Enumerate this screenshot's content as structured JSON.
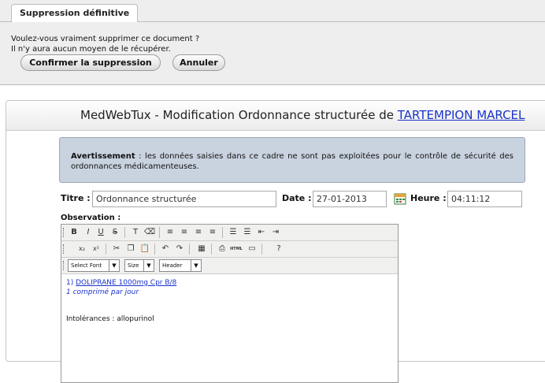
{
  "confirm": {
    "tab_title": "Suppression définitive",
    "message_line1": "Voulez-vous vraiment supprimer ce document ?",
    "message_line2": "Il n'y aura aucun moyen de le récupérer.",
    "confirm_button": "Confirmer la suppression",
    "cancel_button": "Annuler"
  },
  "main": {
    "title_prefix": "MedWebTux - Modification Ordonnance structurée de ",
    "patient_name": "TARTEMPION MARCEL",
    "warning_bold": "Avertissement",
    "warning_text": " : les données saisies dans ce cadre ne sont pas exploitées pour le contrôle de sécurité des ordonnances médicamenteuses."
  },
  "form": {
    "titre_label": "Titre :",
    "titre_value": "Ordonnance structurée",
    "date_label": "Date :",
    "date_value": "27-01-2013",
    "heure_label": "Heure :",
    "heure_value": "04:11:12",
    "observation_label": "Observation :"
  },
  "editor": {
    "toolbar1": [
      "B",
      "I",
      "U",
      "S"
    ],
    "font_select": "Select Font",
    "size_select": "Size",
    "format_select": "Header",
    "content": {
      "drug_index": "1) ",
      "drug_link": "DOLIPRANE 1000mg Cpr B/8",
      "posology": "1 comprimé par jour",
      "intolerances": "Intolérances : allopurinol"
    }
  }
}
